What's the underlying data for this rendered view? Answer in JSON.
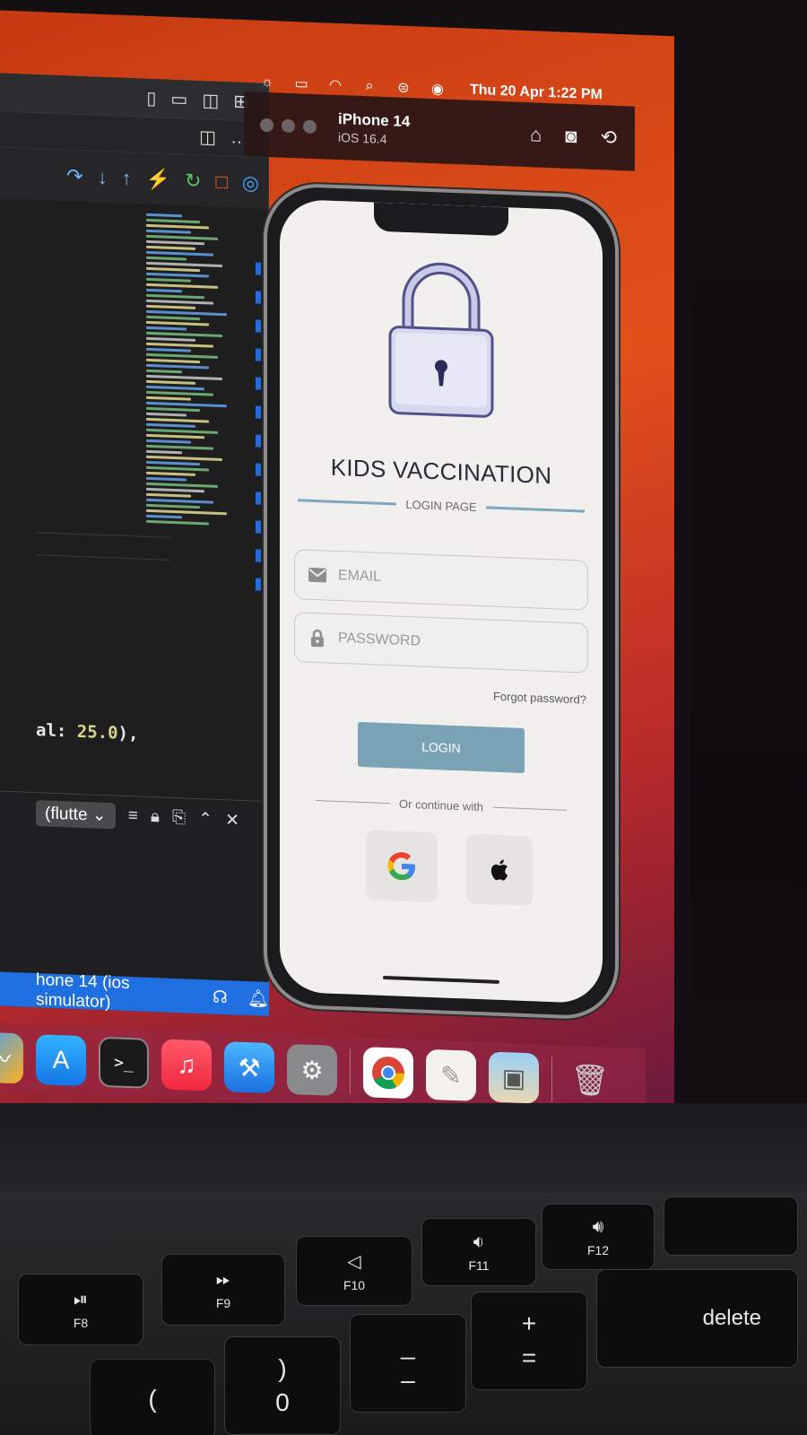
{
  "menubar": {
    "icons": [
      "brightness-icon",
      "battery-icon",
      "wifi-icon",
      "search-icon",
      "control-center-icon",
      "siri-icon"
    ],
    "clock": "Thu 20 Apr  1:22 PM"
  },
  "ide": {
    "code_prefix": "al: ",
    "code_number": "25.0",
    "code_suffix": "),",
    "terminal_select": "(flutte",
    "status_text": "hone 14 (ios simulator)"
  },
  "simulator": {
    "device_name": "iPhone 14",
    "os_version": "iOS 16.4"
  },
  "app": {
    "title": "KIDS VACCINATION",
    "subtitle": "LOGIN PAGE",
    "email_placeholder": "EMAIL",
    "password_placeholder": "PASSWORD",
    "forgot_label": "Forgot password?",
    "login_label": "LOGIN",
    "continue_label": "Or continue with",
    "accent_color": "#7aa3b6"
  },
  "keyboard": {
    "f8": "F8",
    "f9": "F9",
    "f10": "F10",
    "f11": "F11",
    "f12": "F12",
    "delete": "delete",
    "paren_open": "(",
    "paren_close": ")",
    "zero": "0",
    "minus": "–",
    "underscore": "_",
    "plus": "+",
    "equals": "="
  }
}
